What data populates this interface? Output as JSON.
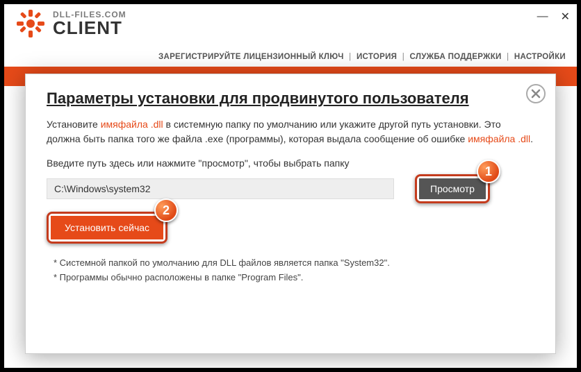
{
  "brand": {
    "top": "DLL-FILES.COM",
    "bottom": "CLIENT"
  },
  "nav": {
    "register": "ЗАРЕГИСТРИРУЙТЕ ЛИЦЕНЗИОННЫЙ КЛЮЧ",
    "history": "ИСТОРИЯ",
    "support": "СЛУЖБА ПОДДЕРЖКИ",
    "settings": "НАСТРОЙКИ"
  },
  "modal": {
    "title": "Параметры установки для продвинутого пользователя",
    "text_prefix": "Установите ",
    "filename1": "имяфайла .dll",
    "text_mid": " в системную папку по умолчанию или укажите другой путь установки. Это должна быть папка того же файла .exe (программы), которая выдала сообщение об ошибке ",
    "filename2": "имяфайла .dll",
    "text_suffix": ".",
    "input_label": "Введите путь здесь или нажмите \"просмотр\", чтобы выбрать папку",
    "path_value": "C:\\Windows\\system32",
    "browse_label": "Просмотр",
    "install_label": "Установить сейчас",
    "hint1": "* Системной папкой по умолчанию для DLL файлов является папка \"System32\".",
    "hint2": "* Программы обычно расположены в папке \"Program Files\"."
  },
  "markers": {
    "one": "1",
    "two": "2"
  },
  "win": {
    "minimize": "—",
    "close": "✕"
  }
}
